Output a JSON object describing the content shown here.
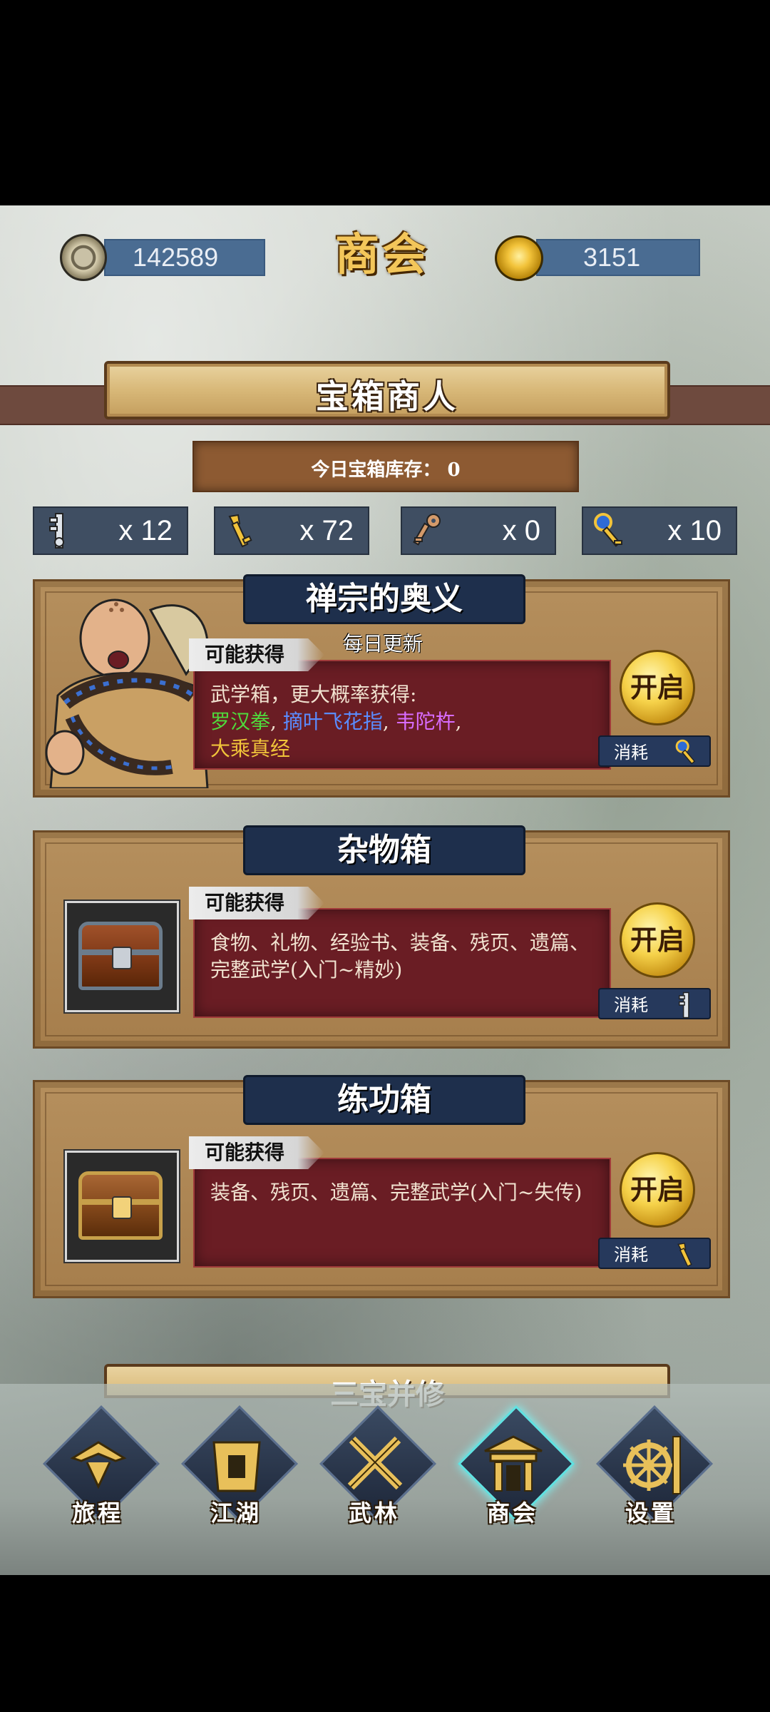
{
  "header": {
    "title": "商会",
    "coins": "142589",
    "ingots": "3151"
  },
  "merchant": {
    "title": "宝箱商人",
    "stock_label": "今日宝箱库存：",
    "stock_value": "0"
  },
  "keys": [
    {
      "icon": "silver-key-icon",
      "count": "x 12"
    },
    {
      "icon": "gold-key-icon",
      "count": "x 72"
    },
    {
      "icon": "bronze-key-icon",
      "count": "x 0"
    },
    {
      "icon": "jade-key-icon",
      "count": "x 10"
    }
  ],
  "chests": [
    {
      "title": "禅宗的奥义",
      "subtitle": "每日更新",
      "tag": "可能获得",
      "desc_prefix": "武学箱，更大概率获得:",
      "items": [
        "罗汉拳",
        "摘叶飞花指",
        "韦陀杵",
        "大乘真经"
      ],
      "open": "开启",
      "cost": "消耗"
    },
    {
      "title": "杂物箱",
      "tag": "可能获得",
      "desc": "食物、礼物、经验书、装备、残页、遗篇、完整武学(入门~精妙)",
      "open": "开启",
      "cost": "消耗"
    },
    {
      "title": "练功箱",
      "tag": "可能获得",
      "desc": "装备、残页、遗篇、完整武学(入门~失传)",
      "open": "开启",
      "cost": "消耗"
    }
  ],
  "next_section": "三宝并修",
  "nav": [
    "旅程",
    "江湖",
    "武林",
    "商会",
    "设置"
  ],
  "colors": {
    "green": "#4fdb3c",
    "blue": "#5a8cff",
    "purple": "#d86cff",
    "gold": "#f0c43a"
  }
}
